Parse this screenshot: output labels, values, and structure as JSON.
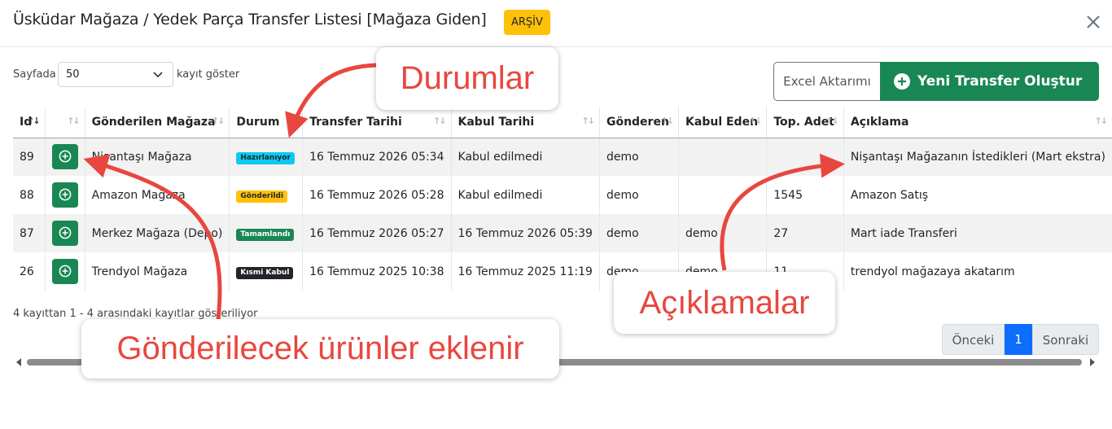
{
  "modal": {
    "title": "Üsküdar Mağaza / Yedek Parça Transfer Listesi [Mağaza Giden]",
    "badge": "ARŞİV"
  },
  "length_menu": {
    "prefix": "Sayfada",
    "value": "50",
    "suffix": "kayıt göster"
  },
  "buttons": {
    "excel": "Excel Aktarımı",
    "new_transfer": "Yeni Transfer Oluştur"
  },
  "table": {
    "headers": [
      "Id",
      "",
      "Gönderilen Mağaza",
      "Durum",
      "Transfer Tarihi",
      "Kabul Tarihi",
      "Gönderen",
      "Kabul Eden",
      "Top. Adet",
      "Açıklama"
    ],
    "rows": [
      {
        "id": "89",
        "store": "Nişantaşı Mağaza",
        "status": "Hazırlanıyor",
        "status_color": "#0dcaf0",
        "status_text_color": "#212529",
        "transfer_date": "16 Temmuz 2026 05:34",
        "accept_date": "Kabul edilmedi",
        "sender": "demo",
        "receiver": "",
        "qty": "",
        "note": "Nişantaşı Mağazanın İstedikleri (Mart ekstra)"
      },
      {
        "id": "88",
        "store": "Amazon Mağaza",
        "status": "Gönderildi",
        "status_color": "#ffc107",
        "status_text_color": "#212529",
        "transfer_date": "16 Temmuz 2026 05:28",
        "accept_date": "Kabul edilmedi",
        "sender": "demo",
        "receiver": "",
        "qty": "1545",
        "note": "Amazon Satış"
      },
      {
        "id": "87",
        "store": "Merkez Mağaza (Depo)",
        "status": "Tamamlandı",
        "status_color": "#198754",
        "status_text_color": "#ffffff",
        "transfer_date": "16 Temmuz 2026 05:27",
        "accept_date": "16 Temmuz 2026 05:39",
        "sender": "demo",
        "receiver": "demo",
        "qty": "27",
        "note": "Mart iade Transferi"
      },
      {
        "id": "26",
        "store": "Trendyol Mağaza",
        "status": "Kısmi Kabul",
        "status_color": "#212529",
        "status_text_color": "#ffffff",
        "transfer_date": "16 Temmuz 2025 10:38",
        "accept_date": "16 Temmuz 2025 11:19",
        "sender": "demo",
        "receiver": "demo",
        "qty": "11",
        "note": "trendyol mağazaya akatarım"
      }
    ]
  },
  "info_text": "4 kayıttan 1 - 4 arasındaki kayıtlar gösteriliyor",
  "pagination": {
    "prev": "Önceki",
    "current": "1",
    "next": "Sonraki"
  },
  "callouts": {
    "durumlar": "Durumlar",
    "aciklamalar": "Açıklamalar",
    "urunler": "Gönderilecek ürünler eklenir"
  },
  "colors": {
    "primary": "#0d6efd",
    "success": "#198754",
    "warning": "#ffc107",
    "annotation": "#e8473f"
  },
  "icons": [
    "close-icon",
    "chevron-down-icon",
    "plus-circle-icon",
    "sort-icon"
  ]
}
